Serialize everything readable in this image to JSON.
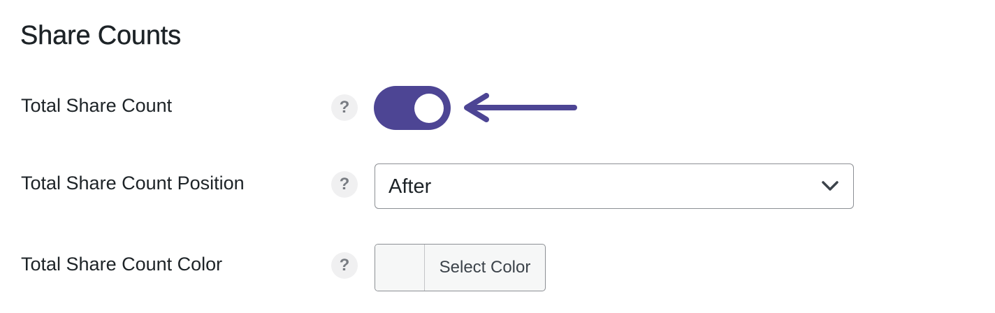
{
  "section": {
    "title": "Share Counts"
  },
  "rows": [
    {
      "label": "Total Share Count",
      "help": "?",
      "control": "toggle",
      "enabled": true
    },
    {
      "label": "Total Share Count Position",
      "help": "?",
      "control": "select",
      "selected": "After"
    },
    {
      "label": "Total Share Count Color",
      "help": "?",
      "control": "color-picker",
      "button_label": "Select Color"
    }
  ],
  "colors": {
    "accent": "#4d4594",
    "text": "#1d2327",
    "help_bg": "#f0f0f1",
    "border": "#8c8f94"
  },
  "icons": {
    "arrow": "left-arrow-icon",
    "chevron": "chevron-down-icon",
    "help": "question-mark-icon"
  }
}
